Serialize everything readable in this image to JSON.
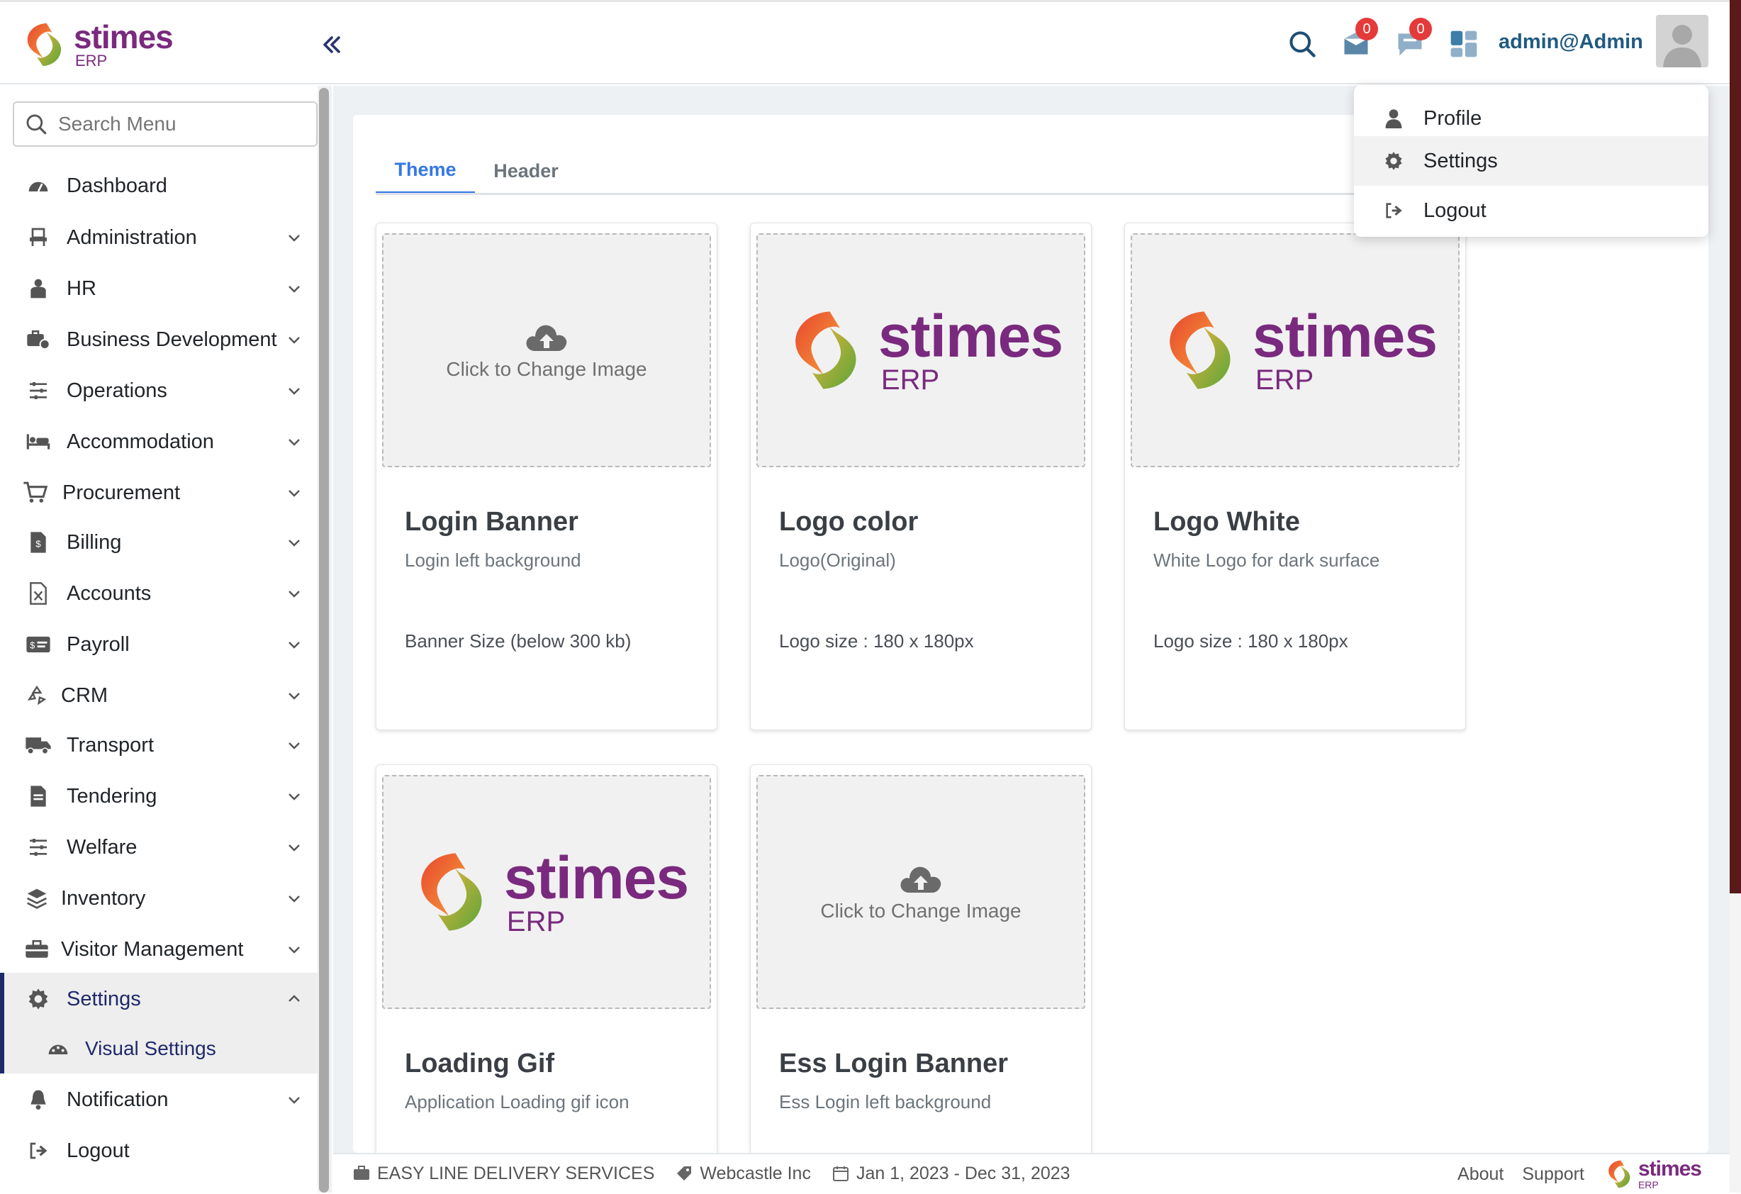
{
  "brand": {
    "name": "stimes",
    "sub": "ERP"
  },
  "header": {
    "user": "admin@Admin",
    "badges": {
      "mail": "0",
      "chat": "0"
    }
  },
  "search": {
    "placeholder": "Search Menu"
  },
  "sidebar": {
    "items": [
      {
        "label": "Dashboard"
      },
      {
        "label": "Administration"
      },
      {
        "label": "HR"
      },
      {
        "label": "Business Development"
      },
      {
        "label": "Operations"
      },
      {
        "label": "Accommodation"
      },
      {
        "label": "Procurement"
      },
      {
        "label": "Billing"
      },
      {
        "label": "Accounts"
      },
      {
        "label": "Payroll"
      },
      {
        "label": "CRM"
      },
      {
        "label": "Transport"
      },
      {
        "label": "Tendering"
      },
      {
        "label": "Welfare"
      },
      {
        "label": "Inventory"
      },
      {
        "label": "Visitor Management"
      },
      {
        "label": "Settings"
      },
      {
        "label": "Notification"
      },
      {
        "label": "Logout"
      }
    ],
    "settings_sub": {
      "label": "Visual Settings"
    }
  },
  "tabs": {
    "theme": "Theme",
    "header": "Header"
  },
  "cards": [
    {
      "title": "Login Banner",
      "subtitle": "Login left background",
      "note": "Banner Size (below 300 kb)",
      "upload": "Click to Change Image"
    },
    {
      "title": "Logo color",
      "subtitle": "Logo(Original)",
      "note": "Logo size : 180 x 180px"
    },
    {
      "title": "Logo White",
      "subtitle": "White Logo for dark surface",
      "note": "Logo size : 180 x 180px"
    },
    {
      "title": "Loading Gif",
      "subtitle": "Application Loading gif icon"
    },
    {
      "title": "Ess Login Banner",
      "subtitle": "Ess Login left background",
      "upload": "Click to Change Image"
    }
  ],
  "dropdown": {
    "profile": "Profile",
    "settings": "Settings",
    "logout": "Logout"
  },
  "footer": {
    "company": "EASY LINE DELIVERY SERVICES",
    "tenant": "Webcastle Inc",
    "period": "Jan 1, 2023 - Dec 31, 2023",
    "about": "About",
    "support": "Support"
  },
  "colors": {
    "accent": "#3578e5",
    "brand_purple": "#7a2a7e",
    "nav_dark": "#1f2a6b",
    "badge": "#e43a3a"
  }
}
